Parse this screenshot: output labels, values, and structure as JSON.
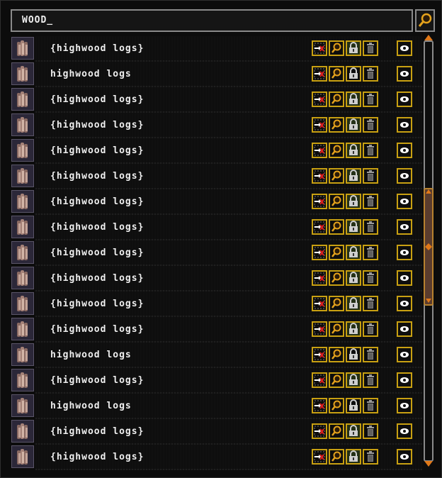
{
  "search": {
    "query": "WOOD_",
    "icon": "magnifier-icon"
  },
  "colors": {
    "button_border": "#c8a012",
    "lock_on_bg": "#243016",
    "scroll_thumb": "#5a3c2e"
  },
  "rows": [
    {
      "label": "{highwood logs}",
      "locked": true
    },
    {
      "label": "highwood logs",
      "locked": false
    },
    {
      "label": "{highwood logs}",
      "locked": true
    },
    {
      "label": "{highwood logs}",
      "locked": true
    },
    {
      "label": "{highwood logs}",
      "locked": true
    },
    {
      "label": "{highwood logs}",
      "locked": true
    },
    {
      "label": "{highwood logs}",
      "locked": true
    },
    {
      "label": "{highwood logs}",
      "locked": true
    },
    {
      "label": "{highwood logs}",
      "locked": true
    },
    {
      "label": "{highwood logs}",
      "locked": true
    },
    {
      "label": "{highwood logs}",
      "locked": true
    },
    {
      "label": "{highwood logs}",
      "locked": true
    },
    {
      "label": "highwood logs",
      "locked": false
    },
    {
      "label": "{highwood logs}",
      "locked": true
    },
    {
      "label": "highwood logs",
      "locked": false
    },
    {
      "label": "{highwood logs}",
      "locked": true
    },
    {
      "label": "{highwood logs}",
      "locked": true
    }
  ],
  "row_icons": {
    "item": "highwood-logs-icon",
    "buttons": [
      "dump-icon",
      "view-magnifier-icon",
      "lock-icon",
      "trash-icon"
    ],
    "visibility": "eye-icon"
  }
}
